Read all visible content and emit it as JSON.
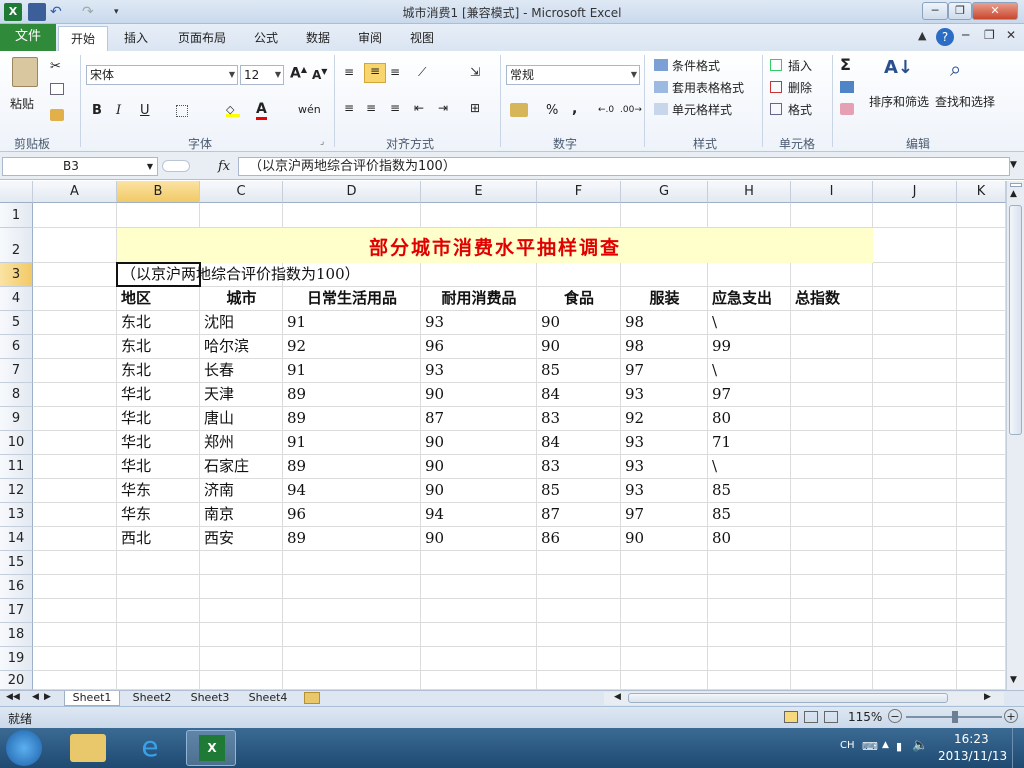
{
  "window": {
    "title": "城市消费1  [兼容模式]  - Microsoft Excel"
  },
  "tabs": [
    {
      "label": "文件"
    },
    {
      "label": "开始"
    },
    {
      "label": "插入"
    },
    {
      "label": "页面布局"
    },
    {
      "label": "公式"
    },
    {
      "label": "数据"
    },
    {
      "label": "审阅"
    },
    {
      "label": "视图"
    }
  ],
  "ribbon": {
    "clipboard": {
      "paste_label": "粘贴",
      "group_label": "剪贴板"
    },
    "font": {
      "name": "宋体",
      "size": "12",
      "group_label": "字体",
      "bold": "B",
      "italic": "I",
      "underline": "U",
      "grow": "A",
      "shrink": "A",
      "font_color_glyph": "A"
    },
    "alignment": {
      "group_label": "对齐方式"
    },
    "number": {
      "format": "常规",
      "percent": "%",
      "comma": ",",
      "group_label": "数字"
    },
    "styles": {
      "conditional": "条件格式",
      "table": "套用表格格式",
      "cell_styles": "单元格样式",
      "group_label": "样式"
    },
    "cells": {
      "insert": "插入",
      "delete": "删除",
      "format": "格式",
      "group_label": "单元格"
    },
    "editing": {
      "sum": "Σ",
      "sort_filter": "排序和筛选",
      "find_select": "查找和选择",
      "group_label": "编辑"
    }
  },
  "formula_bar": {
    "name_box": "B3",
    "fx": "fx",
    "content": "（以京沪两地综合评价指数为100）"
  },
  "columns": [
    "A",
    "B",
    "C",
    "D",
    "E",
    "F",
    "G",
    "H",
    "I",
    "J",
    "K"
  ],
  "rows": [
    "1",
    "2",
    "3",
    "4",
    "5",
    "6",
    "7",
    "8",
    "9",
    "10",
    "11",
    "12",
    "13",
    "14",
    "15",
    "16",
    "17",
    "18",
    "19",
    "20"
  ],
  "sheet": {
    "title": "部分城市消费水平抽样调查",
    "subtitle": "（以京沪两地综合评价指数为100）",
    "headers": [
      "地区",
      "城市",
      "日常生活用品",
      "耐用消费品",
      "食品",
      "服装",
      "应急支出",
      "总指数"
    ],
    "data": [
      [
        "东北",
        "沈阳",
        "91",
        "93",
        "90",
        "98",
        "\\"
      ],
      [
        "东北",
        "哈尔滨",
        "92",
        "96",
        "90",
        "98",
        "99"
      ],
      [
        "东北",
        "长春",
        "91",
        "93",
        "85",
        "97",
        "\\"
      ],
      [
        "华北",
        "天津",
        "89",
        "90",
        "84",
        "93",
        "97"
      ],
      [
        "华北",
        "唐山",
        "89",
        "87",
        "83",
        "92",
        "80"
      ],
      [
        "华北",
        "郑州",
        "91",
        "90",
        "84",
        "93",
        "71"
      ],
      [
        "华北",
        "石家庄",
        "89",
        "90",
        "83",
        "93",
        "\\"
      ],
      [
        "华东",
        "济南",
        "94",
        "90",
        "85",
        "93",
        "85"
      ],
      [
        "华东",
        "南京",
        "96",
        "94",
        "87",
        "97",
        "85"
      ],
      [
        "西北",
        "西安",
        "89",
        "90",
        "86",
        "90",
        "80"
      ]
    ]
  },
  "sheet_tabs": [
    "Sheet1",
    "Sheet2",
    "Sheet3",
    "Sheet4"
  ],
  "status": {
    "ready": "就绪",
    "zoom": "115%"
  },
  "taskbar": {
    "lang": "CH",
    "time": "16:23",
    "date": "2013/11/13"
  },
  "colors": {
    "title_red": "#e00000",
    "title_fill": "#ffffcc",
    "file_tab": "#2f8a3a",
    "selected_header": "#f7d98b"
  }
}
